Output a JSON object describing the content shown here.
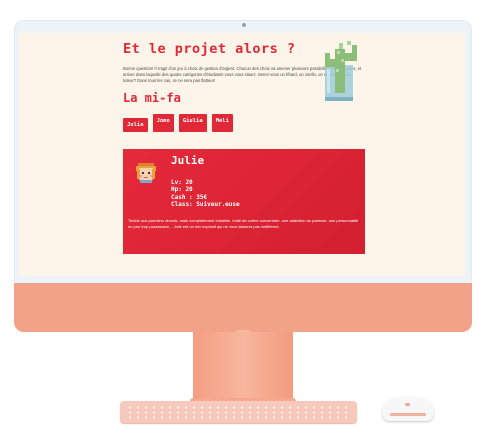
{
  "page": {
    "heading": "Et le projet alors ?",
    "intro": "Bonne question! Il s'agit d'un jeu à choix de gestion d'argent. Chacun des choix va amener plusieurs possibilités de dépenses, et arriver dans laquelle des quatre catégories d'étudiants vous vous situez. Serez-vous un fêtard, un intello, un suiveur, ou un tuteur? Dans tous les cas, ce ne sera pas flatteur!",
    "subheading": "La mi-fa",
    "tabs": [
      {
        "label": "Julie"
      },
      {
        "label": "Jomo"
      },
      {
        "label": "Giulia"
      },
      {
        "label": "Meli"
      }
    ],
    "active_tab": "Julie"
  },
  "profile": {
    "name": "Julie",
    "stats": [
      {
        "text": "Lv: 20"
      },
      {
        "text": "Hp: 20"
      },
      {
        "text": "Cash : 35€"
      },
      {
        "text": "Class: Suiveur.euse"
      }
    ],
    "description": "Timide aux premiers abords, mais complètement chiatible. Imité de colère concentrée, une addiction au paresse, une personnalité un peu trop possessive... Julie est un mix explosif qui ne vous laissera pas indifférent."
  },
  "colors": {
    "accent": "#e02837",
    "background": "#fdf4ea",
    "imac_body": "#f2a286"
  },
  "icons": {
    "avatar": "pixel-girl-avatar",
    "decoration": "pixel-cactus-jar"
  }
}
